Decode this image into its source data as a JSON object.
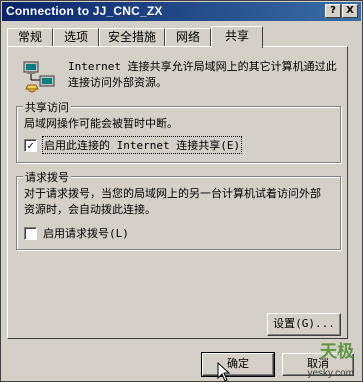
{
  "window": {
    "title": "Connection to JJ_CNC_ZX",
    "help_button": "?",
    "close_button": "X"
  },
  "tabs": [
    {
      "label": "常规",
      "active": false
    },
    {
      "label": "选项",
      "active": false
    },
    {
      "label": "安全措施",
      "active": false
    },
    {
      "label": "网络",
      "active": false
    },
    {
      "label": "共享",
      "active": true
    }
  ],
  "intro": {
    "icon": "shared-connection-icon",
    "text": "Internet 连接共享允许局域网上的其它计算机通过此连接访问外部资源。"
  },
  "share_access": {
    "title": "共享访问",
    "description": "局域网操作可能会被暂时中断。",
    "checkbox_label": "启用此连接的 Internet 连接共享(E)",
    "checked": true
  },
  "dial_on_demand": {
    "title": "请求拨号",
    "description": "对于请求拨号，当您的局域网上的另一台计算机试着访问外部资源时，会自动拨此连接。",
    "checkbox_label": "启用请求拨号(L)",
    "checked": false
  },
  "buttons": {
    "settings": "设置(G)...",
    "ok": "确定",
    "cancel": "取消"
  },
  "watermark": {
    "brand": "天极",
    "site": "yesky.com"
  }
}
